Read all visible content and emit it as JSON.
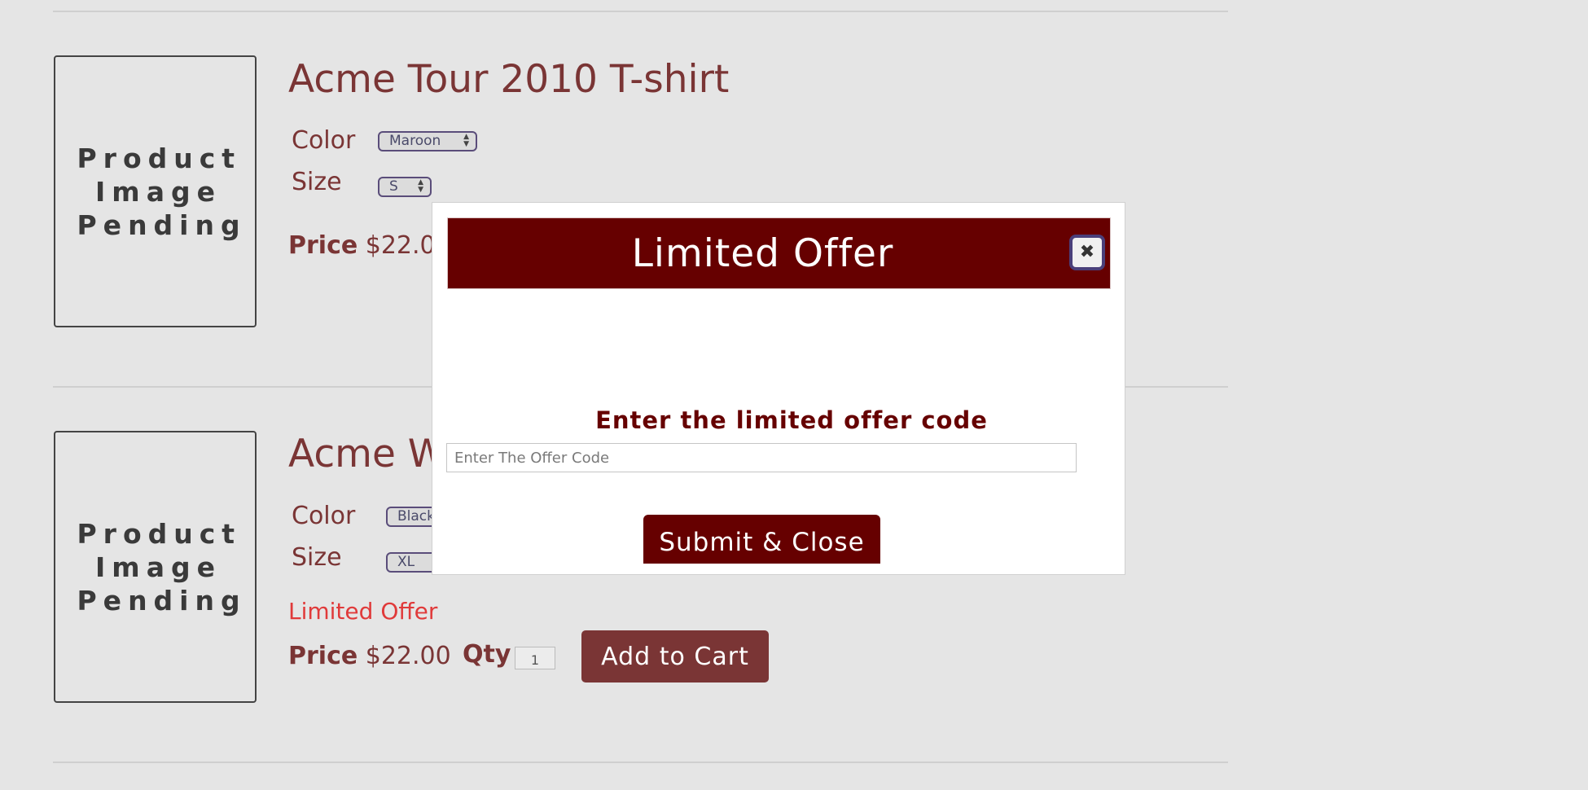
{
  "products": [
    {
      "image_text": "Product Image Pending",
      "title": "Acme Tour 2010 T-shirt",
      "color_label": "Color",
      "color_value": "Maroon",
      "size_label": "Size",
      "size_value": "S",
      "price_label": "Price",
      "price_value": "$22.00"
    },
    {
      "image_text": "Product Image Pending",
      "title": "Acme W",
      "color_label": "Color",
      "color_value": "Black",
      "size_label": "Size",
      "size_value": "XL",
      "limited_offer": "Limited Offer",
      "price_label": "Price",
      "price_value": "$22.00",
      "qty_label": "Qty",
      "qty_value": "1",
      "add_to_cart": "Add to Cart"
    }
  ],
  "dialog": {
    "title": "Limited Offer",
    "close_icon": "close-icon",
    "prompt": "Enter the limited offer code",
    "input_placeholder": "Enter The Offer Code",
    "submit_label": "Submit & Close"
  },
  "colors": {
    "brand": "#7a3535",
    "dialog_header": "#660000",
    "limited_offer_text": "#e03a3a",
    "page_bg": "#e5e5e5"
  }
}
